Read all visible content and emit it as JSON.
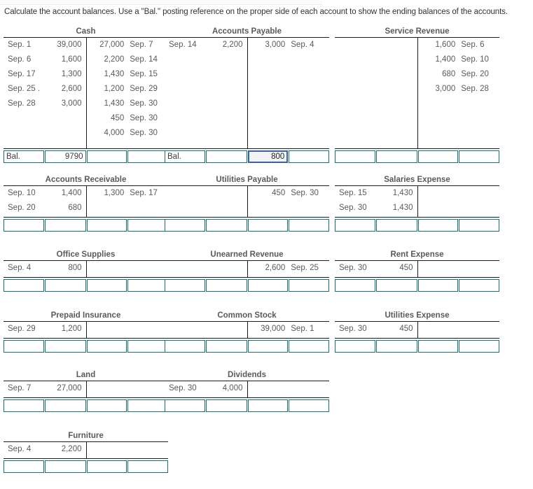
{
  "instruction": "Calculate the account balances. Use a \"Bal.\" posting reference on the proper side of each account to show the ending balances of the accounts.",
  "colors": {
    "rule": "#1a1a1a",
    "input_border": "#16706e",
    "focus_border": "#3a5fa8",
    "text": "#5a5a5a",
    "instruction_text": "#333333"
  },
  "accounts": [
    {
      "id": "cash",
      "title": "Cash",
      "col": 0,
      "row": 0,
      "debits": [
        {
          "ref": "Sep. 1",
          "amount": "39,000"
        },
        {
          "ref": "Sep. 6",
          "amount": "1,600"
        },
        {
          "ref": "Sep. 17",
          "amount": "1,300"
        },
        {
          "ref": "Sep. 25 .",
          "amount": "2,600"
        },
        {
          "ref": "Sep. 28",
          "amount": "3,000"
        }
      ],
      "credits": [
        {
          "amount": "27,000",
          "ref": "Sep. 7"
        },
        {
          "amount": "2,200",
          "ref": "Sep. 14"
        },
        {
          "amount": "1,430",
          "ref": "Sep. 15"
        },
        {
          "amount": "1,200",
          "ref": "Sep. 29"
        },
        {
          "amount": "1,430",
          "ref": "Sep. 30"
        },
        {
          "amount": "450",
          "ref": "Sep. 30"
        },
        {
          "amount": "4,000",
          "ref": "Sep. 30"
        }
      ],
      "inputs": [
        {
          "name": "debit-ref",
          "value": "Bal.",
          "align": "left",
          "focused": false
        },
        {
          "name": "debit-amount",
          "value": "9790",
          "align": "right",
          "focused": false
        },
        {
          "name": "credit-amount",
          "value": "",
          "align": "right",
          "focused": false
        },
        {
          "name": "credit-ref",
          "value": "",
          "align": "right",
          "focused": false
        }
      ]
    },
    {
      "id": "accounts-payable",
      "title": "Accounts Payable",
      "col": 1,
      "row": 0,
      "debits": [
        {
          "ref": "Sep. 14",
          "amount": "2,200"
        }
      ],
      "credits": [
        {
          "amount": "3,000",
          "ref": "Sep. 4"
        }
      ],
      "inputs": [
        {
          "name": "debit-ref",
          "value": "Bal.",
          "align": "left",
          "focused": false
        },
        {
          "name": "debit-amount",
          "value": "",
          "align": "right",
          "focused": false
        },
        {
          "name": "credit-amount",
          "value": "800",
          "align": "right",
          "focused": true
        },
        {
          "name": "credit-ref",
          "value": "",
          "align": "right",
          "focused": false
        }
      ]
    },
    {
      "id": "service-revenue",
      "title": "Service Revenue",
      "col": 2,
      "row": 0,
      "debits": [],
      "credits": [
        {
          "amount": "1,600",
          "ref": "Sep. 6"
        },
        {
          "amount": "1,400",
          "ref": "Sep. 10"
        },
        {
          "amount": "680",
          "ref": "Sep. 20"
        },
        {
          "amount": "3,000",
          "ref": "Sep. 28"
        }
      ],
      "inputs": [
        {
          "name": "debit-ref",
          "value": "",
          "align": "left",
          "focused": false
        },
        {
          "name": "debit-amount",
          "value": "",
          "align": "right",
          "focused": false
        },
        {
          "name": "credit-amount",
          "value": "",
          "align": "right",
          "focused": false
        },
        {
          "name": "credit-ref",
          "value": "",
          "align": "right",
          "focused": false
        }
      ]
    },
    {
      "id": "accounts-receivable",
      "title": "Accounts Receivable",
      "col": 0,
      "row": 1,
      "debits": [
        {
          "ref": "Sep. 10",
          "amount": "1,400"
        },
        {
          "ref": "Sep. 20",
          "amount": "680"
        }
      ],
      "credits": [
        {
          "amount": "1,300",
          "ref": "Sep. 17"
        }
      ],
      "inputs": [
        {
          "name": "debit-ref",
          "value": "",
          "align": "left",
          "focused": false
        },
        {
          "name": "debit-amount",
          "value": "",
          "align": "right",
          "focused": false
        },
        {
          "name": "credit-amount",
          "value": "",
          "align": "right",
          "focused": false
        },
        {
          "name": "credit-ref",
          "value": "",
          "align": "right",
          "focused": false
        }
      ]
    },
    {
      "id": "utilities-payable",
      "title": "Utilities Payable",
      "col": 1,
      "row": 1,
      "debits": [],
      "credits": [
        {
          "amount": "450",
          "ref": "Sep. 30"
        }
      ],
      "inputs": [
        {
          "name": "debit-ref",
          "value": "",
          "align": "left",
          "focused": false
        },
        {
          "name": "debit-amount",
          "value": "",
          "align": "right",
          "focused": false
        },
        {
          "name": "credit-amount",
          "value": "",
          "align": "right",
          "focused": false
        },
        {
          "name": "credit-ref",
          "value": "",
          "align": "right",
          "focused": false
        }
      ]
    },
    {
      "id": "salaries-expense",
      "title": "Salaries Expense",
      "col": 2,
      "row": 1,
      "debits": [
        {
          "ref": "Sep. 15",
          "amount": "1,430"
        },
        {
          "ref": "Sep. 30",
          "amount": "1,430"
        }
      ],
      "credits": [],
      "inputs": [
        {
          "name": "debit-ref",
          "value": "",
          "align": "left",
          "focused": false
        },
        {
          "name": "debit-amount",
          "value": "",
          "align": "right",
          "focused": false
        },
        {
          "name": "credit-amount",
          "value": "",
          "align": "right",
          "focused": false
        },
        {
          "name": "credit-ref",
          "value": "",
          "align": "right",
          "focused": false
        }
      ]
    },
    {
      "id": "office-supplies",
      "title": "Office Supplies",
      "col": 0,
      "row": 2,
      "debits": [
        {
          "ref": "Sep. 4",
          "amount": "800"
        }
      ],
      "credits": [],
      "inputs": [
        {
          "name": "debit-ref",
          "value": "",
          "align": "left",
          "focused": false
        },
        {
          "name": "debit-amount",
          "value": "",
          "align": "right",
          "focused": false
        },
        {
          "name": "credit-amount",
          "value": "",
          "align": "right",
          "focused": false
        },
        {
          "name": "credit-ref",
          "value": "",
          "align": "right",
          "focused": false
        }
      ]
    },
    {
      "id": "unearned-revenue",
      "title": "Unearned Revenue",
      "col": 1,
      "row": 2,
      "debits": [],
      "credits": [
        {
          "amount": "2,600",
          "ref": "Sep. 25"
        }
      ],
      "inputs": [
        {
          "name": "debit-ref",
          "value": "",
          "align": "left",
          "focused": false
        },
        {
          "name": "debit-amount",
          "value": "",
          "align": "right",
          "focused": false
        },
        {
          "name": "credit-amount",
          "value": "",
          "align": "right",
          "focused": false
        },
        {
          "name": "credit-ref",
          "value": "",
          "align": "right",
          "focused": false
        }
      ]
    },
    {
      "id": "rent-expense",
      "title": "Rent Expense",
      "col": 2,
      "row": 2,
      "debits": [
        {
          "ref": "Sep. 30",
          "amount": "450"
        }
      ],
      "credits": [],
      "inputs": [
        {
          "name": "debit-ref",
          "value": "",
          "align": "left",
          "focused": false
        },
        {
          "name": "debit-amount",
          "value": "",
          "align": "right",
          "focused": false
        },
        {
          "name": "credit-amount",
          "value": "",
          "align": "right",
          "focused": false
        },
        {
          "name": "credit-ref",
          "value": "",
          "align": "right",
          "focused": false
        }
      ]
    },
    {
      "id": "prepaid-insurance",
      "title": "Prepaid Insurance",
      "col": 0,
      "row": 3,
      "debits": [
        {
          "ref": "Sep. 29",
          "amount": "1,200"
        }
      ],
      "credits": [],
      "inputs": [
        {
          "name": "debit-ref",
          "value": "",
          "align": "left",
          "focused": false
        },
        {
          "name": "debit-amount",
          "value": "",
          "align": "right",
          "focused": false
        },
        {
          "name": "credit-amount",
          "value": "",
          "align": "right",
          "focused": false
        },
        {
          "name": "credit-ref",
          "value": "",
          "align": "right",
          "focused": false
        }
      ]
    },
    {
      "id": "common-stock",
      "title": "Common Stock",
      "col": 1,
      "row": 3,
      "debits": [],
      "credits": [
        {
          "amount": "39,000",
          "ref": "Sep. 1"
        }
      ],
      "inputs": [
        {
          "name": "debit-ref",
          "value": "",
          "align": "left",
          "focused": false
        },
        {
          "name": "debit-amount",
          "value": "",
          "align": "right",
          "focused": false
        },
        {
          "name": "credit-amount",
          "value": "",
          "align": "right",
          "focused": false
        },
        {
          "name": "credit-ref",
          "value": "",
          "align": "right",
          "focused": false
        }
      ]
    },
    {
      "id": "utilities-expense",
      "title": "Utilities Expense",
      "col": 2,
      "row": 3,
      "debits": [
        {
          "ref": "Sep. 30",
          "amount": "450"
        }
      ],
      "credits": [],
      "inputs": [
        {
          "name": "debit-ref",
          "value": "",
          "align": "left",
          "focused": false
        },
        {
          "name": "debit-amount",
          "value": "",
          "align": "right",
          "focused": false
        },
        {
          "name": "credit-amount",
          "value": "",
          "align": "right",
          "focused": false
        },
        {
          "name": "credit-ref",
          "value": "",
          "align": "right",
          "focused": false
        }
      ]
    },
    {
      "id": "land",
      "title": "Land",
      "col": 0,
      "row": 4,
      "debits": [
        {
          "ref": "Sep. 7",
          "amount": "27,000"
        }
      ],
      "credits": [],
      "inputs": [
        {
          "name": "debit-ref",
          "value": "",
          "align": "left",
          "focused": false
        },
        {
          "name": "debit-amount",
          "value": "",
          "align": "right",
          "focused": false
        },
        {
          "name": "credit-amount",
          "value": "",
          "align": "right",
          "focused": false
        },
        {
          "name": "credit-ref",
          "value": "",
          "align": "right",
          "focused": false
        }
      ]
    },
    {
      "id": "dividends",
      "title": "Dividends",
      "col": 1,
      "row": 4,
      "debits": [
        {
          "ref": "Sep. 30",
          "amount": "4,000"
        }
      ],
      "credits": [],
      "inputs": [
        {
          "name": "debit-ref",
          "value": "",
          "align": "left",
          "focused": false
        },
        {
          "name": "debit-amount",
          "value": "",
          "align": "right",
          "focused": false
        },
        {
          "name": "credit-amount",
          "value": "",
          "align": "right",
          "focused": false
        },
        {
          "name": "credit-ref",
          "value": "",
          "align": "right",
          "focused": false
        }
      ]
    },
    {
      "id": "furniture",
      "title": "Furniture",
      "col": 0,
      "row": 5,
      "debits": [
        {
          "ref": "Sep. 4",
          "amount": "2,200"
        }
      ],
      "credits": [],
      "inputs": [
        {
          "name": "debit-ref",
          "value": "",
          "align": "left",
          "focused": false
        },
        {
          "name": "debit-amount",
          "value": "",
          "align": "right",
          "focused": false
        },
        {
          "name": "credit-amount",
          "value": "",
          "align": "right",
          "focused": false
        },
        {
          "name": "credit-ref",
          "value": "",
          "align": "right",
          "focused": false
        }
      ]
    }
  ],
  "layout": {
    "col_x": [
      5,
      235,
      478
    ],
    "row_y": [
      38,
      250,
      357,
      444,
      529,
      616
    ],
    "row_body_heights": [
      158,
      44,
      23,
      23,
      23,
      23
    ]
  }
}
